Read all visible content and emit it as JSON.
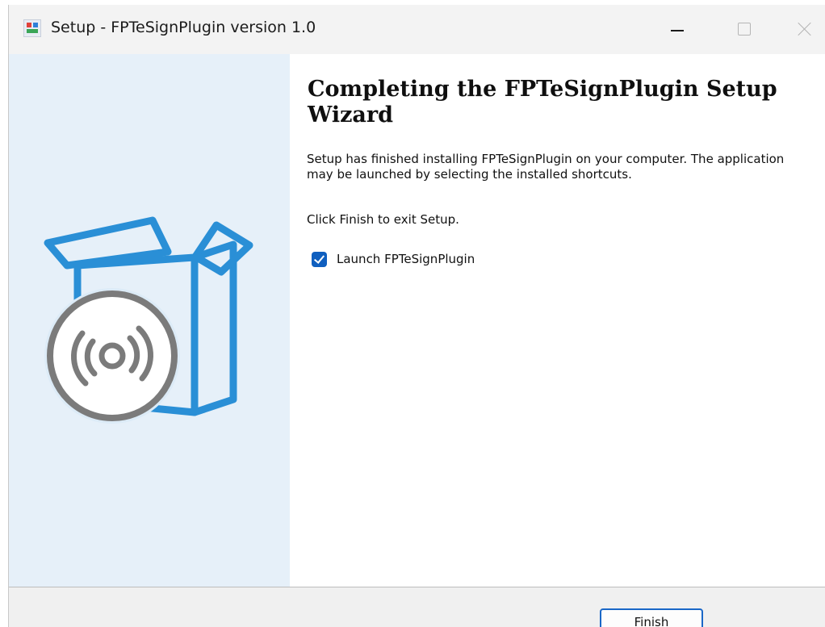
{
  "window": {
    "title": "Setup - FPTeSignPlugin version 1.0",
    "icon": "installer-app-icon",
    "controls": [
      "minimize-icon",
      "maximize-icon",
      "close-icon"
    ]
  },
  "side_image": {
    "icon": "software-box-cd-icon"
  },
  "content": {
    "heading": "Completing the FPTeSignPlugin Setup Wizard",
    "description": "Setup has finished installing FPTeSignPlugin on your computer. The application may be launched by selecting the installed shortcuts.",
    "instruction": "Click Finish to exit Setup.",
    "launch_checkbox": {
      "label": "Launch FPTeSignPlugin",
      "checked": true
    }
  },
  "footer": {
    "finish_label": "Finish"
  },
  "colors": {
    "accent": "#0f5fbf",
    "side_panel": "#e6f0f9",
    "box_blue": "#2a8fd6",
    "disc_gray": "#7b7b7b"
  }
}
